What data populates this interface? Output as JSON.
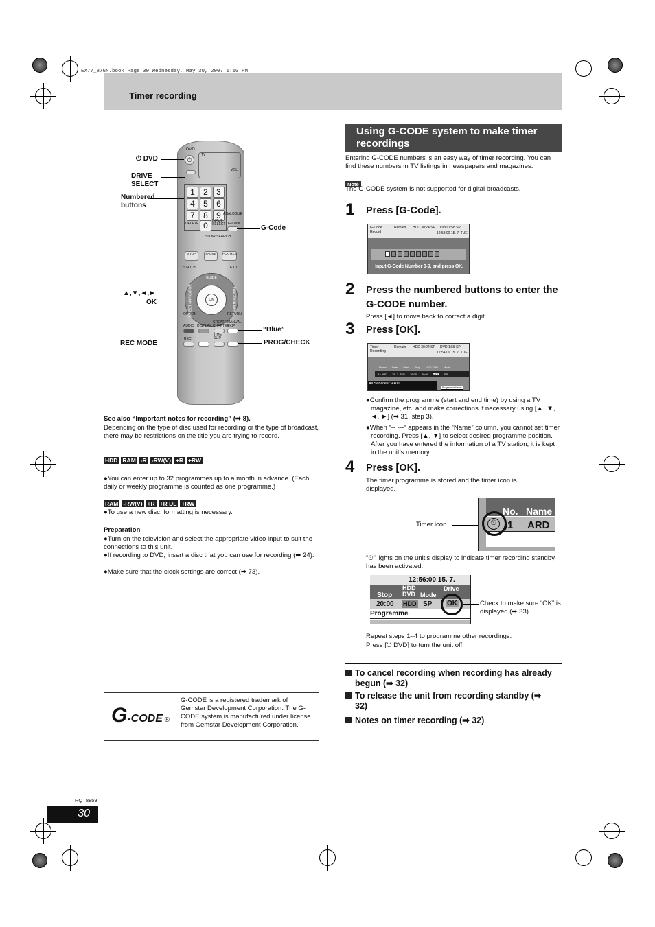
{
  "file_info": "EX77_87GN.book  Page 30  Wednesday, May 30, 2007  1:10 PM",
  "header": {
    "title": "Timer recording"
  },
  "remote": {
    "labels": {
      "dvd": "⏻ DVD",
      "drive_select": "DRIVE\nSELECT",
      "numbered": "Numbered\nbuttons",
      "gcode": "G-Code",
      "arrows": "▲,▼,◄,►",
      "ok": "OK",
      "blue": "“Blue”",
      "rec_mode": "REC MODE",
      "prog_check": "PROG/CHECK"
    },
    "keys": [
      "1",
      "2",
      "3",
      "4",
      "5",
      "6",
      "7",
      "8",
      "9",
      "0"
    ],
    "small": {
      "dvd": "DVD",
      "tv": "TV",
      "ch": "CH",
      "vol": "VOL",
      "av": "AV",
      "page": "PAGE",
      "drive": "DRIVE SELECT",
      "delete": "DELETE",
      "input": "INPUT SELECT",
      "gcode": "G-Code",
      "slow": "SLOW/SEARCH",
      "stop": "STOP",
      "pause": "PAUSE",
      "play": "PLAY/x1.3",
      "status": "STATUS",
      "exit": "EXIT",
      "guide": "GUIDE",
      "direct": "DIRECT NAVIGATOR",
      "function": "FUNCTION MENU",
      "okb": "OK",
      "option": "OPTION",
      "return": "RETURN",
      "audio": "AUDIO",
      "display": "DISPLAY",
      "create": "CREATE CHAPTER",
      "manual": "MANUAL SKIP",
      "rec": "REC",
      "recmode": "REC MODE",
      "timeslip": "TIME SLIP",
      "progcheck": "PROG/CHECK",
      "analogue": "ANALOGUE"
    }
  },
  "left": {
    "see_also": "See also “Important notes for recording” (➡ 8).",
    "para": "Depending on the type of disc used for recording or the type of broadcast, there may be restrictions on the title you are trying to record.",
    "badges1": [
      "HDD",
      "RAM",
      "-R",
      "-RW(V)",
      "+R",
      "+RW"
    ],
    "bullet1": "●You can enter up to 32 programmes up to a month in advance. (Each daily or weekly programme is counted as one programme.)",
    "badges2": [
      "RAM",
      "-RW(V)",
      "+R",
      "+R DL",
      "+RW"
    ],
    "bullet2": "●To use a new disc, formatting is necessary.",
    "prep_title": "Preparation",
    "prep": [
      "●Turn on the television and select the appropriate video input to suit the connections to this unit.",
      "●If recording to DVD, insert a disc that you can use for recording (➡ 24).",
      "●Make sure that the clock settings are correct (➡ 73)."
    ]
  },
  "gcode_box": {
    "logo": "G-CODE®",
    "text": "G-CODE is a registered trademark of Gemstar Development Corporation. The G-CODE system is manufactured under license from Gemstar Development Corporation."
  },
  "right": {
    "section_title": "Using G-CODE system to make timer recordings",
    "intro": "Entering G-CODE numbers is an easy way of timer recording. You can find these numbers in TV listings in newspapers and magazines.",
    "note_label": "Note",
    "note": "The G-CODE system is not supported for digital broadcasts.",
    "steps": [
      {
        "n": "1",
        "title": "Press [G-Code]."
      },
      {
        "n": "2",
        "title": "Press the numbered buttons to enter the G-CODE number.",
        "sub": "Press [◄] to move back to correct a digit."
      },
      {
        "n": "3",
        "title": "Press [OK].",
        "bullets": [
          "●Confirm the programme (start and end time) by using a TV magazine, etc. and make corrections if necessary using [▲, ▼, ◄, ►] (➡ 31, step 3).",
          "●When “-- ---” appears in the “Name” column, you cannot set timer recording. Press [▲, ▼] to select desired programme position. After you have entered the information of a TV station, it is kept in the unit’s memory."
        ]
      },
      {
        "n": "4",
        "title": "Press [OK].",
        "sub": "The timer programme is stored and the timer icon is displayed."
      }
    ],
    "screen1": {
      "title": "G-Code\nRecord",
      "remain": "Remain",
      "hdd": "HDD  30:24 SP",
      "dvd": "DVD  1:58 SP",
      "time": "12:53:00  15. 7.  TUE",
      "prompt": "Input G-Code Number 0-9, and press OK."
    },
    "screen2": {
      "title": "Timer\nRecording",
      "remain": "Remain",
      "hdd": "HDD  30:24 SP",
      "dvd": "DVD  1:58 SP",
      "time": "12:54:00  15. 7.  TUE",
      "cols": [
        "Name",
        "Date",
        "Start",
        "Stop",
        "HDD DVD",
        "Mode"
      ],
      "row": [
        "3A ARD",
        "15. 7. TUE",
        "19:00",
        "20:00",
        "HDD",
        "SP"
      ],
      "services": "All Services : ARD",
      "prog_name": "Programme Name"
    },
    "timer_icon_label": "Timer icon",
    "screen3": {
      "no": "No.",
      "name": "Name",
      "num": ")1",
      "station": "ARD"
    },
    "timer_note": "“⏲” lights on the unit’s display to indicate timer recording standby has been activated.",
    "screen4": {
      "time": "12:56:00   15. 7.  TUE",
      "stop": "Stop",
      "hdd_dvd": "HDD\nDVD",
      "mode": "Mode",
      "drive": "Drive",
      "stop_val": "20:00",
      "hdd": "HDD",
      "sp": "SP",
      "ok": "OK",
      "programme": "Programme"
    },
    "check_note": "Check to make sure “OK” is displayed (➡ 33).",
    "repeat": "Repeat steps 1–4 to programme other recordings.",
    "turn_off": "Press [⏻ DVD] to turn the unit off.",
    "links": [
      "To cancel recording when recording has already begun (➡ 32)",
      "To release the unit from recording standby (➡ 32)",
      "Notes on timer recording (➡ 32)"
    ]
  },
  "footer": {
    "code": "RQT8859",
    "page": "30"
  }
}
